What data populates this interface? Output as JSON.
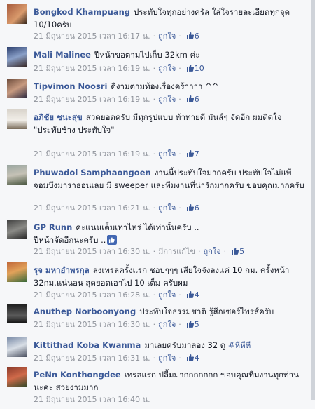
{
  "comments": [
    {
      "name": "Bongkod Khampuang",
      "text": "ประทับใจทุกอย่างครัล ใส่ใจรายละเอียดทุกจุด 10/10ครับ",
      "time": "21 มิถุนายน 2015 เวลา 16:17 น.",
      "like_label": "ถูกใจ",
      "likes": "6"
    },
    {
      "name": "Mali Malinee",
      "text": "ปีหน้าขอตามไปเก็บ 32km ค่ะ",
      "time": "21 มิถุนายน 2015 เวลา 16:19 น.",
      "like_label": "ถูกใจ",
      "likes": "10"
    },
    {
      "name": "Tipvimon Noosri",
      "text": "ดีงามตามท้องเรื่องคร้าาาา ^^",
      "time": "21 มิถุนายน 2015 เวลา 16:19 น.",
      "like_label": "ถูกใจ",
      "likes": "6"
    },
    {
      "name": "อภิชัย ชนะสุข",
      "text": "สวดยอดครับ มีทุกรูปแบบ ท้าทายดี มันส์ๆ จัดอีก ผมติดใจ",
      "text2": "\"ประทับช้าง ประทับใจ\"",
      "time": "21 มิถุนายน 2015 เวลา 16:19 น.",
      "like_label": "ถูกใจ",
      "likes": "7"
    },
    {
      "name": "Phuwadol Samphaongoen",
      "text": "งานนี้ประทับใจมากครับ ประทับใจไม่แพ้จอมบึงมาราธอนเลย มี sweeper และทีมงานที่น่ารักมากครับ ขอบคุณมากครับ",
      "time": "21 มิถุนายน 2015 เวลา 16:21 น.",
      "like_label": "ถูกใจ",
      "likes": "6"
    },
    {
      "name": "GP Runn",
      "text": "คะแนนเต็มเท่าไหร่ ได้เท่านั้นครับ ..",
      "text2": "ปีหน้าจัดอีกนะครับ ..",
      "time": "21 มิถุนายน 2015 เวลา 16:30 น.",
      "edited": "มีการแก้ไข",
      "like_label": "ถูกใจ",
      "likes": "5"
    },
    {
      "name": "รุจ มหาอำพรกุล",
      "text": "ลงเทรลครั้งแรก ชอบๆๆๆ เสียใจจังลงแค่ 10 กม. ครั้งหน้า 32กม.แน่นอน สุดยอดเอาไป 10 เต็ม ครับผม",
      "time": "21 มิถุนายน 2015 เวลา 16:28 น.",
      "like_label": "ถูกใจ",
      "likes": "4"
    },
    {
      "name": "Anuthep Norboonyong",
      "text": "ประทับใจธรรมชาติ รู้สึกเซอร์ไพรส์ครับ",
      "time": "21 มิถุนายน 2015 เวลา 16:30 น.",
      "like_label": "ถูกใจ",
      "likes": "5"
    },
    {
      "name": "Kittithad Koba Kwanma",
      "text": "มาเลยครับมาลอง 32 ดู",
      "hashtag": "#หีหีหี",
      "time": "21 มิถุนายน 2015 เวลา 16:31 น.",
      "like_label": "ถูกใจ",
      "likes": "4"
    },
    {
      "name": "PeNn Konthongdee",
      "text": "เทรลแรก ปลื้มมากกกกกกก ขอบคุณทีมงานทุกท่านนะคะ สวยงามมาก",
      "time": "21 มิถุนายน 2015 เวลา 16:40 น.",
      "like_label": "ถูกใจ",
      "likes": ""
    }
  ],
  "colors": {
    "link": "#3b5998",
    "meta": "#90949c",
    "background": "#f6f7f9"
  },
  "icons": {
    "thumb": "thumbs-up-icon"
  }
}
